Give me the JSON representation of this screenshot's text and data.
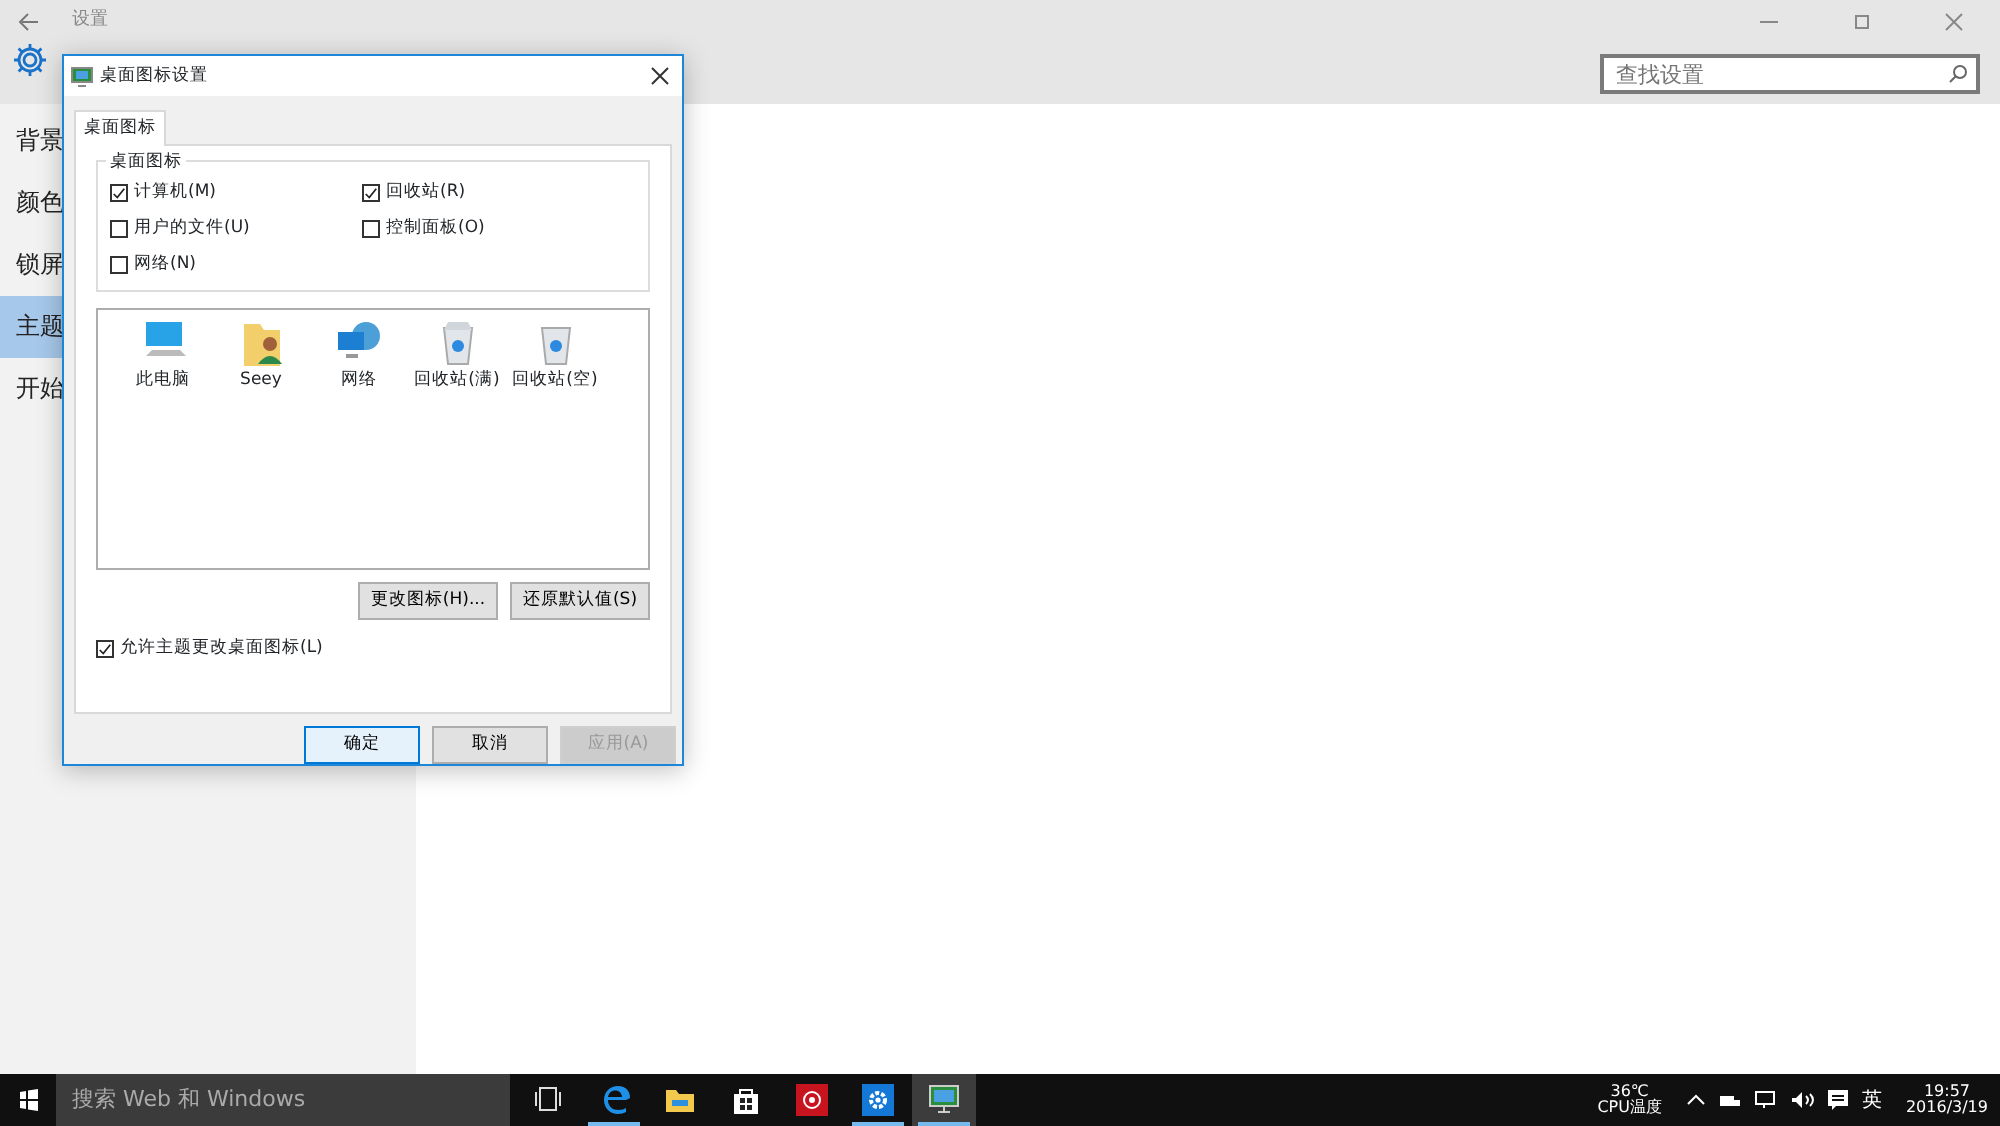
{
  "window": {
    "title": "设置"
  },
  "search": {
    "placeholder": "查找设置"
  },
  "sidebar": {
    "items": [
      {
        "label": "背景",
        "selected": false
      },
      {
        "label": "颜色",
        "selected": false
      },
      {
        "label": "锁屏",
        "selected": false
      },
      {
        "label": "主题",
        "selected": true
      },
      {
        "label": "开始",
        "selected": false
      }
    ]
  },
  "dialog": {
    "title": "桌面图标设置",
    "tabs": [
      {
        "label": "桌面图标",
        "selected": true
      }
    ],
    "group_title": "桌面图标",
    "checkboxes": [
      {
        "label": "计算机(M)",
        "checked": true
      },
      {
        "label": "回收站(R)",
        "checked": true
      },
      {
        "label": "用户的文件(U)",
        "checked": false
      },
      {
        "label": "控制面板(O)",
        "checked": false
      },
      {
        "label": "网络(N)",
        "checked": false
      }
    ],
    "icons": [
      {
        "label": "此电脑",
        "kind": "computer"
      },
      {
        "label": "Seey",
        "kind": "user"
      },
      {
        "label": "网络",
        "kind": "network"
      },
      {
        "label": "回收站(满)",
        "kind": "bin-full"
      },
      {
        "label": "回收站(空)",
        "kind": "bin-empty"
      }
    ],
    "icon_buttons": [
      "更改图标(H)...",
      "还原默认值(S)"
    ],
    "allow_themes": {
      "label": "允许主题更改桌面图标(L)",
      "checked": true
    },
    "buttons": [
      {
        "label": "确定",
        "kind": "default",
        "disabled": false
      },
      {
        "label": "取消",
        "kind": "normal",
        "disabled": false
      },
      {
        "label": "应用(A)",
        "kind": "normal",
        "disabled": true
      }
    ]
  },
  "taskbar": {
    "search_placeholder": "搜索 Web 和 Windows",
    "apps": [
      {
        "kind": "taskview",
        "running": false,
        "selected": false
      },
      {
        "kind": "edge",
        "running": true,
        "selected": false
      },
      {
        "kind": "explorer",
        "running": false,
        "selected": false
      },
      {
        "kind": "store",
        "running": false,
        "selected": false
      },
      {
        "kind": "red",
        "running": false,
        "selected": false
      },
      {
        "kind": "settings",
        "running": true,
        "selected": false
      },
      {
        "kind": "display",
        "running": true,
        "selected": true
      }
    ],
    "temperature": "36℃",
    "temperature_label": "CPU温度",
    "ime": "英",
    "time": "19:57",
    "date": "2016/3/19"
  }
}
